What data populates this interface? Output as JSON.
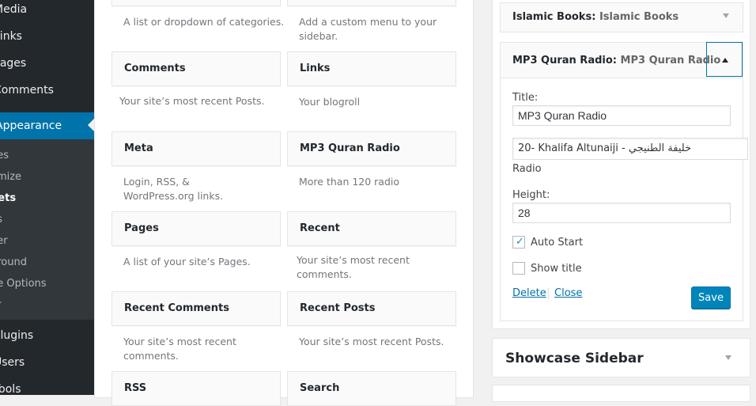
{
  "admin_menu": {
    "items": [
      {
        "label": "Media"
      },
      {
        "label": "Links"
      },
      {
        "label": "Pages"
      },
      {
        "label": "Comments"
      },
      {
        "label": "Appearance"
      },
      {
        "label": "Plugins"
      },
      {
        "label": "Users"
      },
      {
        "label": "Tools"
      }
    ],
    "submenu": [
      "nes",
      "omize",
      "gets",
      "us",
      "der",
      "ground",
      "ne Options",
      "or"
    ]
  },
  "available_widgets": [
    {
      "title": "",
      "desc": "A list or dropdown of categories."
    },
    {
      "title": "",
      "desc": "Add a custom menu to your sidebar."
    },
    {
      "title": "Comments",
      "desc": "Your site’s most recent Posts."
    },
    {
      "title": "Links",
      "desc": "Your blogroll"
    },
    {
      "title": "Meta",
      "desc": "Login, RSS, & WordPress.org links."
    },
    {
      "title": "MP3 Quran Radio",
      "desc": "More than 120 radio"
    },
    {
      "title": "Pages",
      "desc": "A list of your site’s Pages."
    },
    {
      "title": "Recent",
      "desc": "Your site’s most recent comments."
    },
    {
      "title": "Recent Comments",
      "desc": "Your site’s most recent comments."
    },
    {
      "title": "Recent Posts",
      "desc": "Your site’s most recent Posts."
    },
    {
      "title": "RSS",
      "desc": ""
    },
    {
      "title": "Search",
      "desc": ""
    }
  ],
  "sidebar": {
    "islamic_books": {
      "name": "Islamic Books",
      "instance": "Islamic Books"
    },
    "mp3_widget": {
      "name": "MP3 Quran Radio",
      "instance": "MP3 Quran Radio",
      "title_label": "Title:",
      "title_value": "MP3 Quran Radio",
      "radio_select": "20- Khalifa Altunaiji - خليفة الطنيجي",
      "radio_label": "Radio",
      "height_label": "Height:",
      "height_value": "28",
      "auto_start_label": "Auto Start",
      "auto_start_checked": true,
      "show_title_label": "Show title",
      "show_title_checked": false,
      "delete_label": "Delete",
      "separator": "|",
      "close_label": "Close",
      "save_label": "Save"
    },
    "showcase": {
      "title": "Showcase Sidebar"
    }
  }
}
